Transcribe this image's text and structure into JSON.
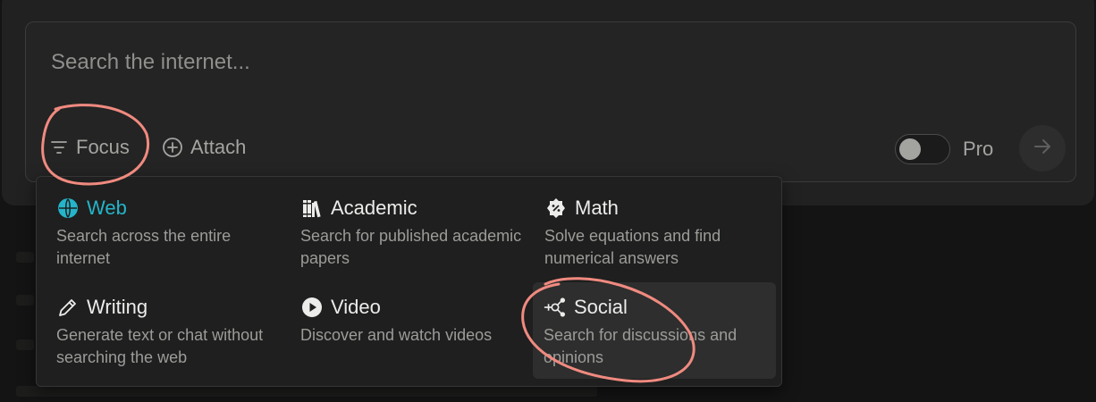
{
  "search": {
    "placeholder": "Search the internet..."
  },
  "toolbar": {
    "focus_label": "Focus",
    "attach_label": "Attach",
    "pro_label": "Pro",
    "pro_enabled": false
  },
  "focus_menu": {
    "options": [
      {
        "id": "web",
        "title": "Web",
        "description": "Search across the entire internet",
        "icon": "globe-icon",
        "active": true
      },
      {
        "id": "academic",
        "title": "Academic",
        "description": "Search for published academic papers",
        "icon": "books-icon",
        "active": false
      },
      {
        "id": "math",
        "title": "Math",
        "description": "Solve equations and find numerical answers",
        "icon": "math-icon",
        "active": false
      },
      {
        "id": "writing",
        "title": "Writing",
        "description": "Generate text or chat without searching the web",
        "icon": "pencil-icon",
        "active": false
      },
      {
        "id": "video",
        "title": "Video",
        "description": "Discover and watch videos",
        "icon": "play-icon",
        "active": false
      },
      {
        "id": "social",
        "title": "Social",
        "description": "Search for discussions and opinions",
        "icon": "social-icon",
        "active": false,
        "hovered": true
      }
    ]
  },
  "colors": {
    "accent": "#25b4c9",
    "annotation": "#f08a80",
    "background": "#141414",
    "panel": "#232423"
  }
}
